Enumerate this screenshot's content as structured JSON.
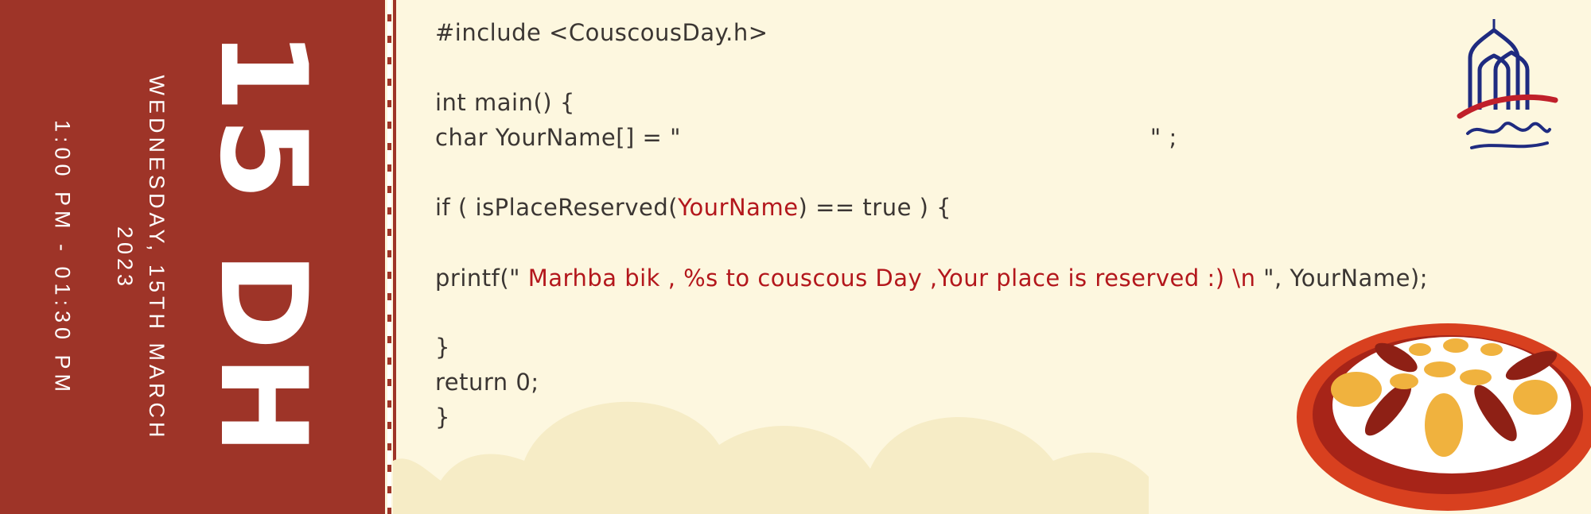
{
  "stub": {
    "price": "15 DH",
    "date_line1": "WEDNESDAY, 15TH MARCH",
    "date_line2": "2023",
    "time": "1:00 PM - 01:30 PM"
  },
  "code": {
    "include": "#include <CouscousDay.h>",
    "main": "int main() {",
    "char_decl_start": "char YourName[] = \"",
    "char_decl_end": "\" ;",
    "if_start": "if ( isPlaceReserved(",
    "if_arg": "YourName",
    "if_end": ") == true ) {",
    "printf_start": "printf(\"",
    "printf_msg": " Marhba bik , %s to couscous Day ,Your place is reserved :) \\n ",
    "printf_end": "\", YourName);",
    "close_if": "}",
    "return_stmt": "return 0;",
    "close_main": "}"
  },
  "icons": {
    "logo": "mosque-logo-icon",
    "dish": "couscous-dish-icon"
  },
  "colors": {
    "stub": "#9e3428",
    "background": "#fdf7df",
    "code_text": "#3b3633",
    "code_accent": "#b3171c"
  }
}
